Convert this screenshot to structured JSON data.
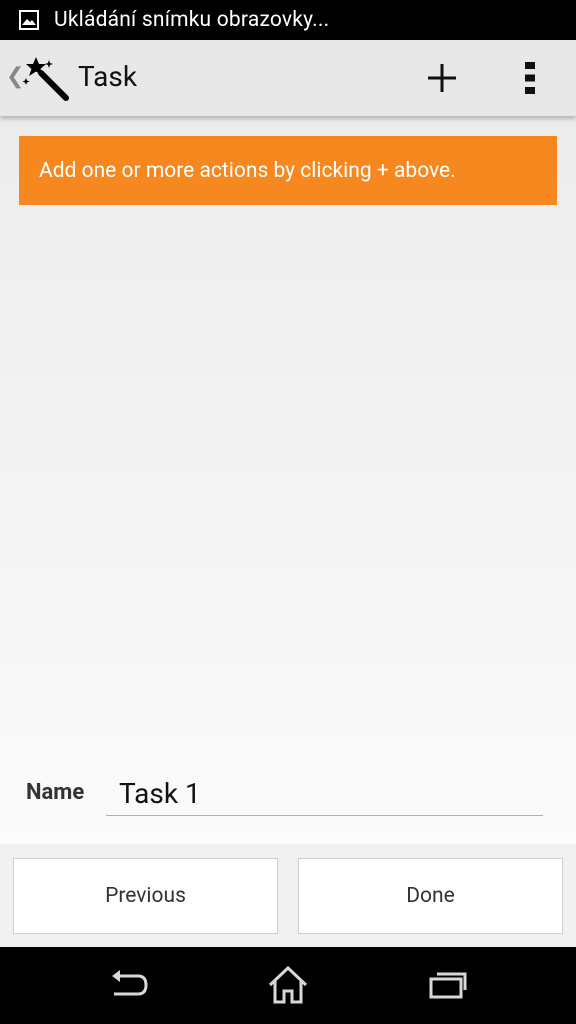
{
  "status_bar": {
    "notification_icon": "image-icon",
    "text": "Ukládání snímku obrazovky..."
  },
  "action_bar": {
    "title": "Task",
    "app_icon": "magic-wand-icon",
    "add_icon": "plus-icon",
    "overflow_icon": "overflow-menu-icon"
  },
  "hint": {
    "text": "Add one or more actions by clicking + above."
  },
  "form": {
    "name_label": "Name",
    "name_value": "Task 1"
  },
  "buttons": {
    "previous": "Previous",
    "done": "Done"
  },
  "nav_bar": {
    "back_icon": "back-icon",
    "home_icon": "home-icon",
    "recent_icon": "recent-apps-icon"
  },
  "colors": {
    "accent": "#f7871f",
    "action_bar_bg": "#e8e8e8",
    "status_bar_bg": "#000000"
  }
}
